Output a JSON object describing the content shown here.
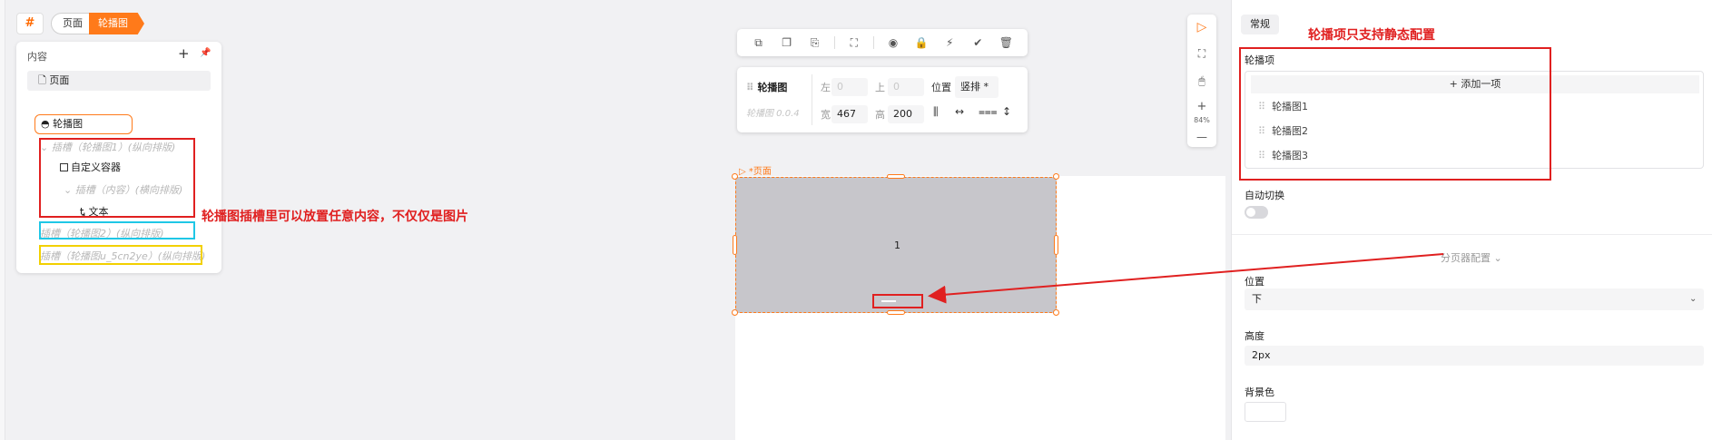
{
  "breadcrumb": {
    "logo": "#",
    "page": "页面",
    "current": "轮播图"
  },
  "outline": {
    "title": "内容",
    "add": "+",
    "pin": "📌",
    "page_item": "页面",
    "carousel_node": "轮播图",
    "slot1": "插槽（轮播图1）(纵向排版)",
    "custom_container": "自定义容器",
    "slot_content": "插槽（内容）(横向排版)",
    "text_node": "文本",
    "slot2": "插槽（轮播图2）(纵向排版)",
    "slot3": "插槽（轮播图u_5cn2ye）(纵向排版)"
  },
  "annotations": {
    "left_note": "轮播图插槽里可以放置任意内容，不仅仅是图片",
    "right_note": "轮播项只支持静态配置"
  },
  "toolbar": {
    "icons": [
      "copy-icon",
      "duplicate-icon",
      "paste-icon",
      "select-parent-icon",
      "hide-icon",
      "lock-icon",
      "flash-icon",
      "check-shield-icon",
      "delete-icon"
    ],
    "glyphs": [
      "⧉",
      "❐",
      "⎘",
      "⛶",
      "◉",
      "🔒",
      "⚡",
      "✔",
      "🗑"
    ]
  },
  "position_panel": {
    "name": "轮播图",
    "version": "轮播图 0.0.4",
    "left_label": "左",
    "left_placeholder": "0",
    "top_label": "上",
    "top_placeholder": "0",
    "position_label": "位置",
    "position_value": "竖排 *",
    "width_label": "宽",
    "width_value": "467",
    "height_label": "高",
    "height_value": "200"
  },
  "vertical_tools": {
    "play": "▷",
    "fullscreen": "⛶",
    "mouse": "🖱",
    "zoom_in": "+",
    "zoom_level": "84%",
    "zoom_out": "—"
  },
  "canvas": {
    "page_tag": "▷ *页面",
    "slide_number": "1"
  },
  "right_panel": {
    "tab": "常规",
    "items_label": "轮播项",
    "add_item": "+ 添加一项",
    "items": [
      "轮播图1",
      "轮播图2",
      "轮播图3"
    ],
    "auto_switch_label": "自动切换",
    "auto_switch_on": false,
    "pager_section": "分页器配置 ⌄",
    "position_label": "位置",
    "position_value": "下",
    "height_label": "高度",
    "height_value": "2px",
    "bg_label": "背景色"
  },
  "colors": {
    "accent": "#ff7a1a",
    "annotation_red": "#e02020",
    "cyan": "#1fc7e6",
    "yellow": "#f2d000",
    "carousel_bg": "#c7c6cb"
  }
}
